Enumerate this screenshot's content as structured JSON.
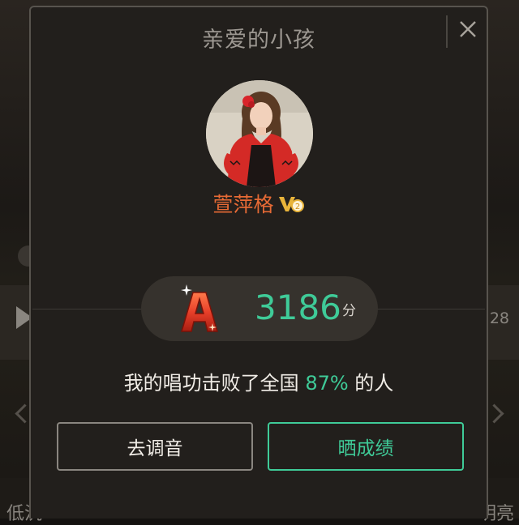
{
  "background": {
    "time_text": "28",
    "low_label": "低沉",
    "high_label": "明亮"
  },
  "dialog": {
    "title": "亲爱的小孩",
    "close_label": "×"
  },
  "user": {
    "name": "萱萍格",
    "badge": "V₂"
  },
  "score": {
    "grade": "A",
    "value": "3186",
    "unit": "分"
  },
  "beat": {
    "prefix": "我的唱功击败了全国 ",
    "percent": "87%",
    "suffix": " 的人"
  },
  "buttons": {
    "tune_label": "去调音",
    "share_label": "晒成绩"
  },
  "colors": {
    "accent": "#3fcb98",
    "username": "#e66a35",
    "grade": "#e8402a"
  }
}
